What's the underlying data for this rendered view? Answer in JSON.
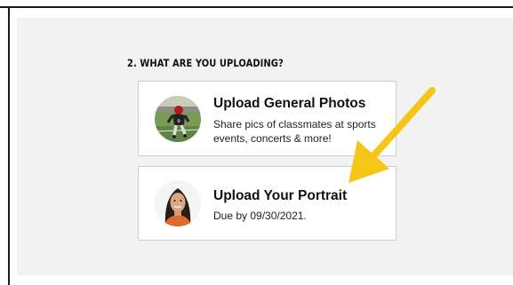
{
  "section": {
    "title": "2. WHAT ARE YOU UPLOADING?"
  },
  "options": [
    {
      "title": "Upload General Photos",
      "description": "Share pics of classmates at sports events, concerts & more!",
      "image": "football-player-photo"
    },
    {
      "title": "Upload Your Portrait",
      "description": "Due by 09/30/2021.",
      "image": "student-portrait-photo"
    }
  ],
  "annotation": {
    "arrow_color": "#f5c518",
    "arrow_target": "Upload Your Portrait"
  },
  "colors": {
    "background": "#f2f2f2",
    "card_border": "#cfcfcf",
    "text": "#111111"
  }
}
